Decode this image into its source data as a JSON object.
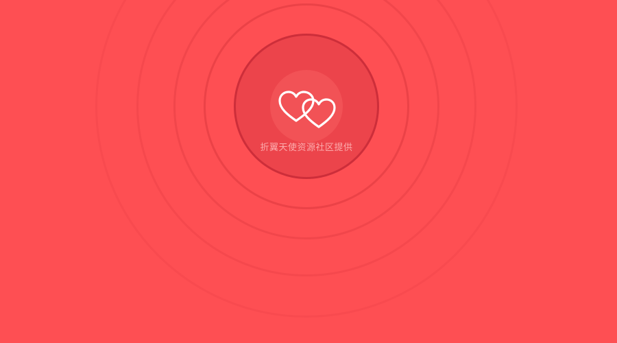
{
  "caption": "折翼天使资源社区提供",
  "icon": "hearts-icon",
  "colors": {
    "background": "#fe4f53",
    "inner_circle": "#ec444b",
    "core": "#f25256",
    "heart_stroke": "#ffffff"
  }
}
